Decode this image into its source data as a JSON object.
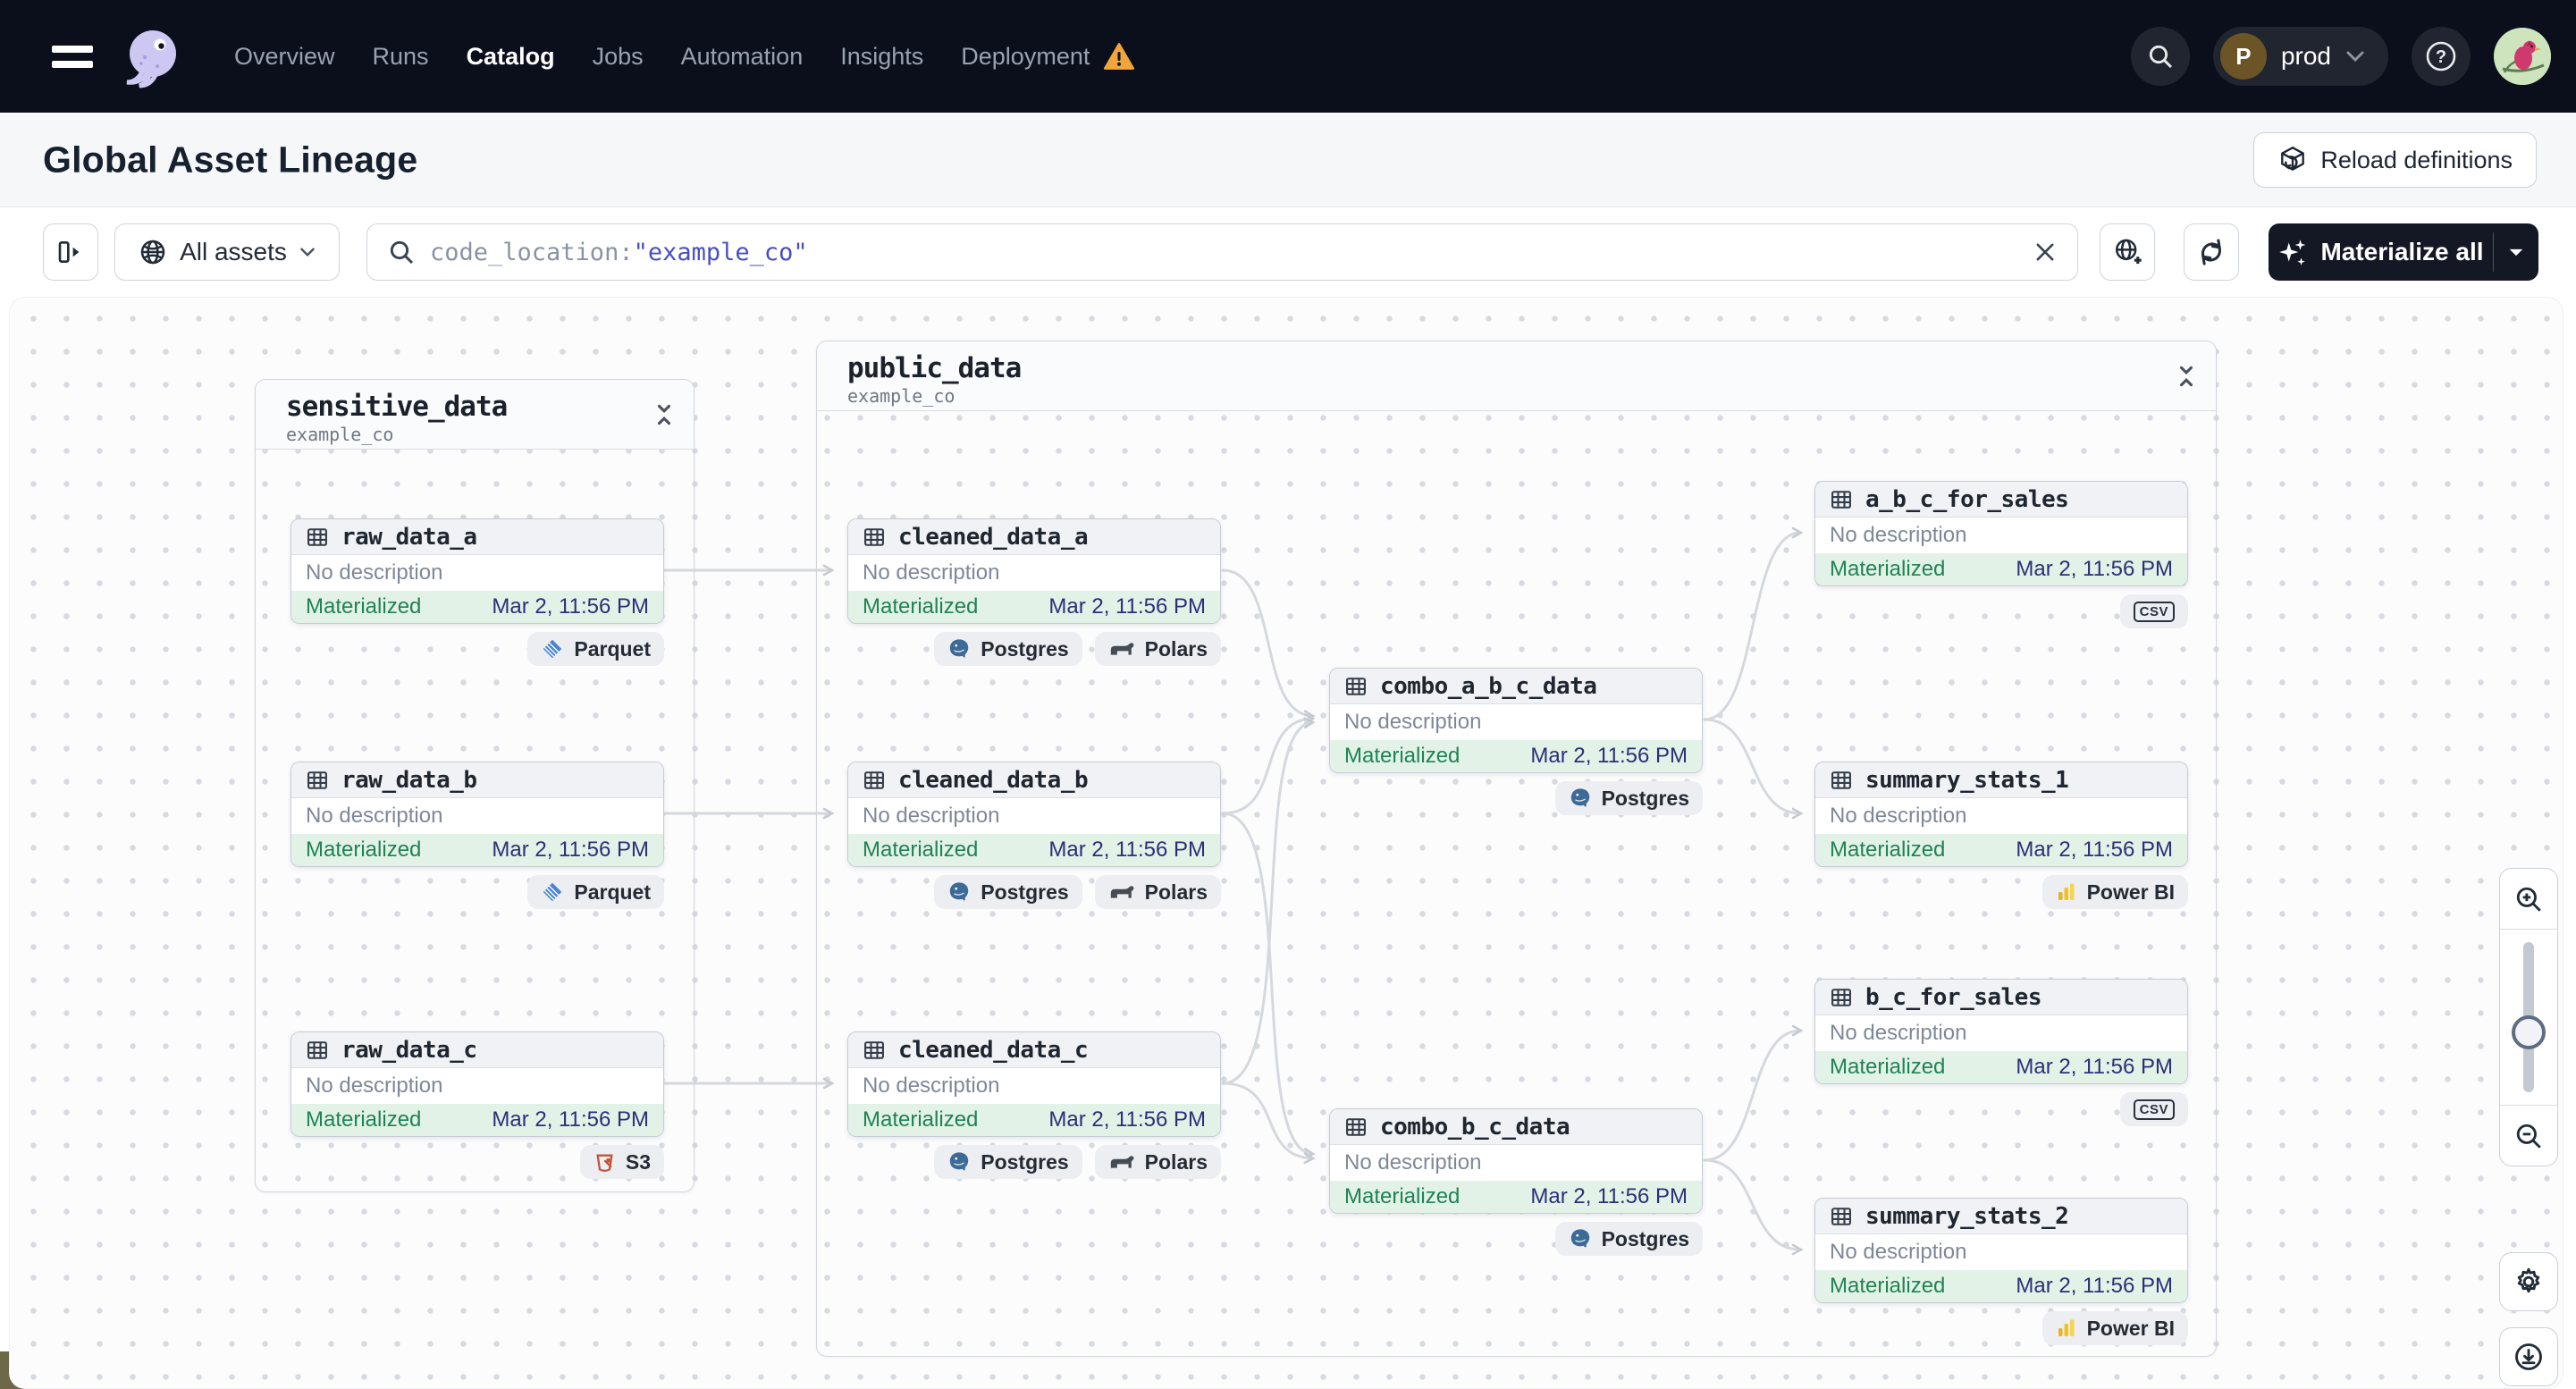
{
  "nav": {
    "menu": [
      "Overview",
      "Runs",
      "Catalog",
      "Jobs",
      "Automation",
      "Insights",
      "Deployment"
    ],
    "active_item": "Catalog",
    "environment": "prod",
    "environment_initial": "P"
  },
  "page": {
    "title": "Global Asset Lineage",
    "reload_button": "Reload definitions"
  },
  "toolbar": {
    "scope_label": "All assets",
    "search_prefix": "code_location:",
    "search_value": "\"example_co\"",
    "materialize_button": "Materialize all"
  },
  "graph": {
    "groups": [
      {
        "name": "sensitive_data",
        "location": "example_co"
      },
      {
        "name": "public_data",
        "location": "example_co"
      }
    ],
    "nodes": [
      {
        "name": "raw_data_a",
        "description": "No description",
        "status": "Materialized",
        "timestamp": "Mar 2, 11:56 PM",
        "tags": [
          {
            "label": "Parquet"
          }
        ]
      },
      {
        "name": "raw_data_b",
        "description": "No description",
        "status": "Materialized",
        "timestamp": "Mar 2, 11:56 PM",
        "tags": [
          {
            "label": "Parquet"
          }
        ]
      },
      {
        "name": "raw_data_c",
        "description": "No description",
        "status": "Materialized",
        "timestamp": "Mar 2, 11:56 PM",
        "tags": [
          {
            "label": "S3"
          }
        ]
      },
      {
        "name": "cleaned_data_a",
        "description": "No description",
        "status": "Materialized",
        "timestamp": "Mar 2, 11:56 PM",
        "tags": [
          {
            "label": "Postgres"
          },
          {
            "label": "Polars"
          }
        ]
      },
      {
        "name": "cleaned_data_b",
        "description": "No description",
        "status": "Materialized",
        "timestamp": "Mar 2, 11:56 PM",
        "tags": [
          {
            "label": "Postgres"
          },
          {
            "label": "Polars"
          }
        ]
      },
      {
        "name": "cleaned_data_c",
        "description": "No description",
        "status": "Materialized",
        "timestamp": "Mar 2, 11:56 PM",
        "tags": [
          {
            "label": "Postgres"
          },
          {
            "label": "Polars"
          }
        ]
      },
      {
        "name": "combo_a_b_c_data",
        "description": "No description",
        "status": "Materialized",
        "timestamp": "Mar 2, 11:56 PM",
        "tags": [
          {
            "label": "Postgres"
          }
        ]
      },
      {
        "name": "combo_b_c_data",
        "description": "No description",
        "status": "Materialized",
        "timestamp": "Mar 2, 11:56 PM",
        "tags": [
          {
            "label": "Postgres"
          }
        ]
      },
      {
        "name": "a_b_c_for_sales",
        "description": "No description",
        "status": "Materialized",
        "timestamp": "Mar 2, 11:56 PM",
        "tags": [
          {
            "label": "CSV"
          }
        ]
      },
      {
        "name": "summary_stats_1",
        "description": "No description",
        "status": "Materialized",
        "timestamp": "Mar 2, 11:56 PM",
        "tags": [
          {
            "label": "Power BI"
          }
        ]
      },
      {
        "name": "b_c_for_sales",
        "description": "No description",
        "status": "Materialized",
        "timestamp": "Mar 2, 11:56 PM",
        "tags": [
          {
            "label": "CSV"
          }
        ]
      },
      {
        "name": "summary_stats_2",
        "description": "No description",
        "status": "Materialized",
        "timestamp": "Mar 2, 11:56 PM",
        "tags": [
          {
            "label": "Power BI"
          }
        ]
      }
    ]
  },
  "icons": {
    "menu": "hamburger",
    "dagster-logo": "octopus",
    "search": "magnifier",
    "help": "?",
    "warning": "orange triangle !",
    "table": "grid",
    "collapse": "chevrons-inward",
    "parquet": "blue diamond",
    "s3": "red bucket",
    "postgres": "elephant",
    "polars": "bear",
    "powerbi": "yellow bars",
    "csv": "CSV box",
    "sparkle": "4-point star",
    "zoom-in": "magnifier+",
    "zoom-out": "magnifier-",
    "gear": "settings",
    "download": "arrow-down-circle"
  },
  "colors": {
    "nav_bg": "#0b0f1c",
    "accent_dark": "#141824",
    "materialized_green": "#208352",
    "status_bg_green": "#e2f2e7",
    "timestamp_indigo": "#2b3077",
    "search_value_indigo": "#474fc0",
    "warning_orange": "#f0a63a",
    "s3_red": "#c0543c",
    "parquet_blue": "#4a83d4",
    "postgres_blue": "#3d6a96",
    "powerbi_yellow": "#f2c21a",
    "edge_gray": "#d5d8dd"
  }
}
